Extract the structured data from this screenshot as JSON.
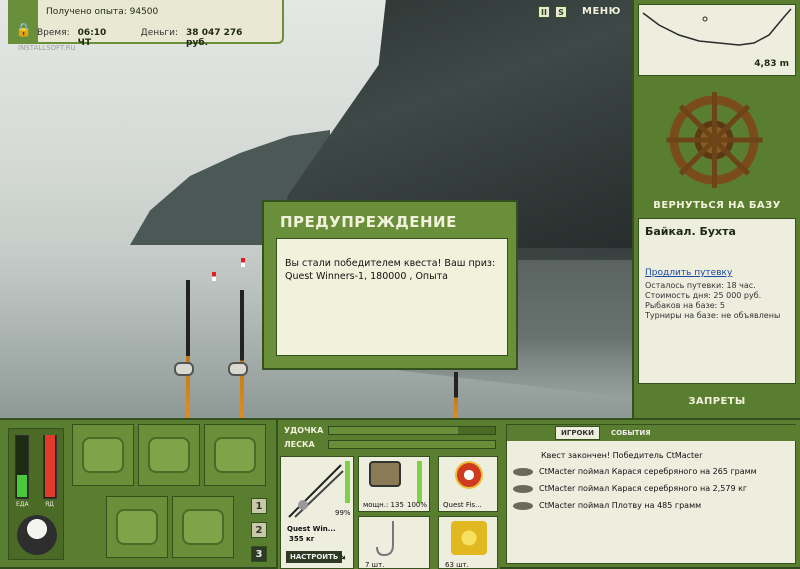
{
  "watermark": "INSTALLSOFT.RU",
  "info": {
    "exp_label": "Получено опыта:",
    "exp_value": "94500",
    "time_label": "Время:",
    "time_value": "06:10 ЧТ",
    "money_label": "Деньги:",
    "money_value": "38 047 276 руб."
  },
  "topbar": {
    "pause_icon": "II",
    "sound_icon": "S",
    "menu": "МЕНЮ"
  },
  "right": {
    "depth": "4,83 m",
    "back_to_base": "ВЕРНУТЬСЯ НА БАЗУ",
    "location": "Байкал. Бухта",
    "extend_link": "Продлить путевку",
    "lines": [
      "Осталось путевки: 18 час.",
      "Стоимость дня: 25 000 руб.",
      "Рыбаков на базе: 5",
      "Турниры на базе: не объявлены"
    ],
    "bans": "ЗАПРЕТЫ"
  },
  "dialog": {
    "title": "ПРЕДУПРЕЖДЕНИЕ",
    "message": "Вы стали победителем квеста! Ваш приз: Quest Winners-1, 180000 , Опыта"
  },
  "meters": {
    "food_label": "ЕДА",
    "poison_label": "ЯД",
    "food_level": 0.35,
    "poison_level": 1.0
  },
  "pages": [
    "1",
    "2",
    "3"
  ],
  "tackle": {
    "rod_label": "УДОЧКА",
    "line_label": "ЛЕСКА",
    "rod_name": "Quest Win...",
    "rod_weight": "355 кг",
    "rod_pct": "99%",
    "reel_power": "мощн.: 135",
    "reel_pct": "100%",
    "line_name": "Quest Fis...",
    "hook_count": "7 шт.",
    "bait_count": "63 шт.",
    "setup_button": "НАСТРОИТЬ"
  },
  "log": {
    "tab_players": "ИГРОКИ",
    "tab_events": "СОБЫТИЯ",
    "lines": [
      "Квест закончен! Победитель CtMacter",
      "CtMacter поймал Карася серебряного на 265 грамм",
      "CtMacter поймал Карася серебряного на 2,579 кг",
      "CtMacter поймал Плотву на 485 грамм"
    ]
  }
}
